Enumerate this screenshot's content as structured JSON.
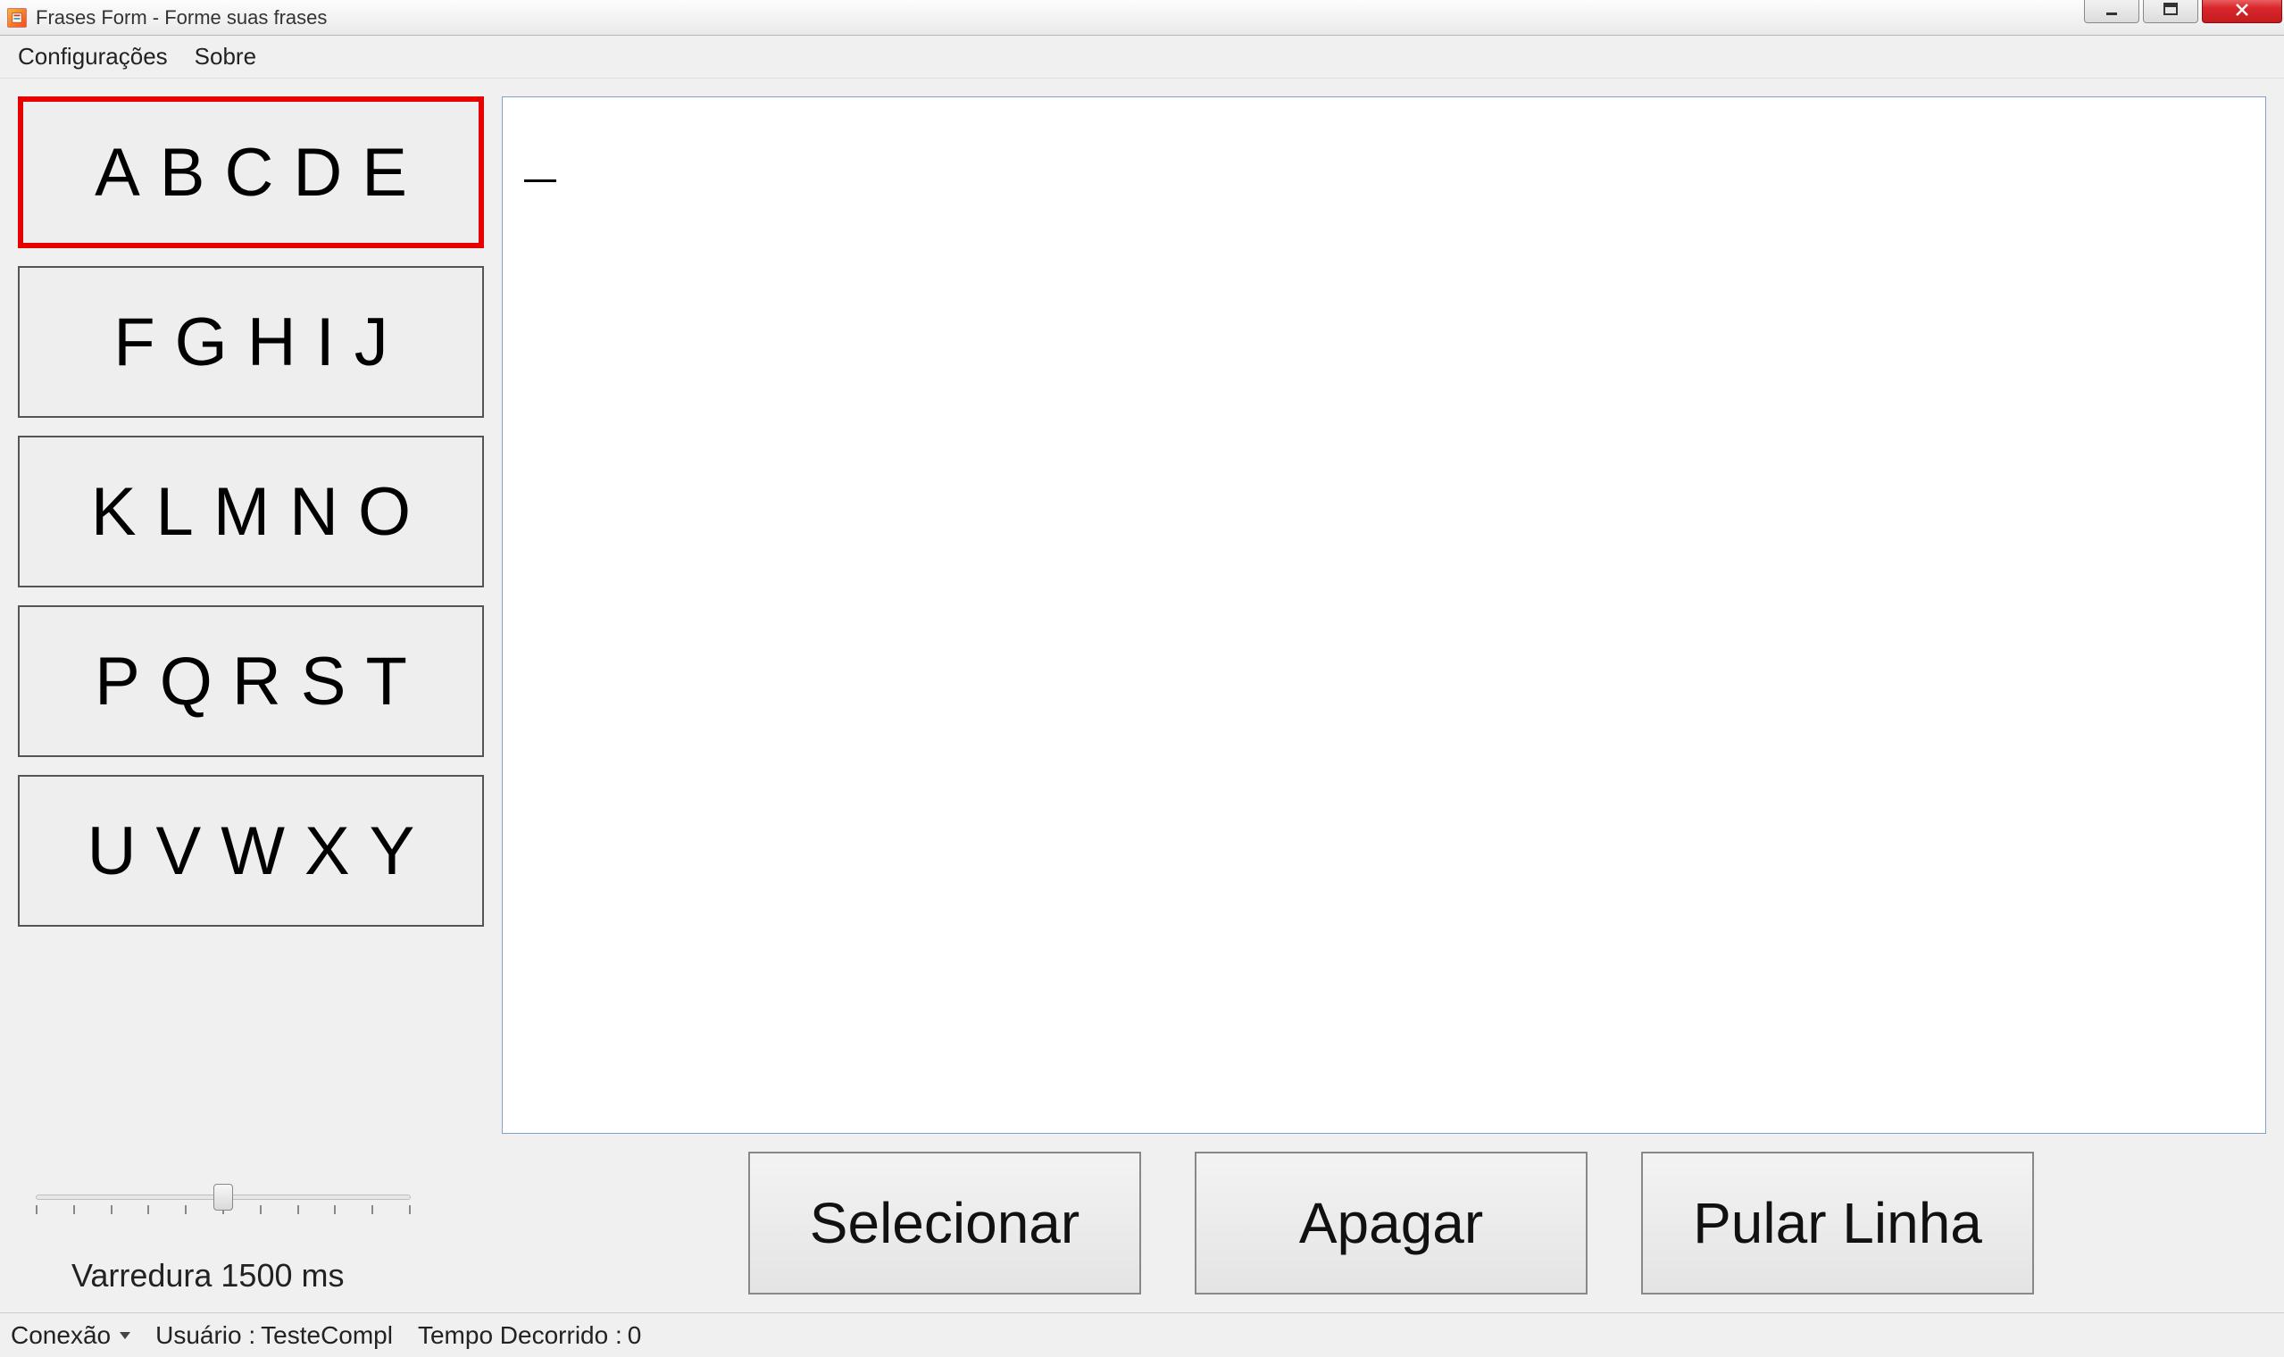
{
  "window": {
    "title": "Frases Form - Forme suas frases"
  },
  "menu": {
    "config": "Configurações",
    "about": "Sobre"
  },
  "letter_groups": [
    {
      "label": "ABCDE",
      "selected": true
    },
    {
      "label": "FGHIJ",
      "selected": false
    },
    {
      "label": "KLMNO",
      "selected": false
    },
    {
      "label": "PQRST",
      "selected": false
    },
    {
      "label": "UVWXY",
      "selected": false
    }
  ],
  "text_area": {
    "content": ""
  },
  "slider": {
    "min": 0,
    "max": 10,
    "value": 5,
    "ticks": 11,
    "label": "Varredura 1500 ms"
  },
  "buttons": {
    "select": "Selecionar",
    "delete": "Apagar",
    "newline": "Pular Linha"
  },
  "status": {
    "connection_label": "Conexão",
    "user_label": "Usuário :",
    "user_value": "TesteCompl",
    "elapsed_label": "Tempo Decorrido :",
    "elapsed_value": "0"
  }
}
